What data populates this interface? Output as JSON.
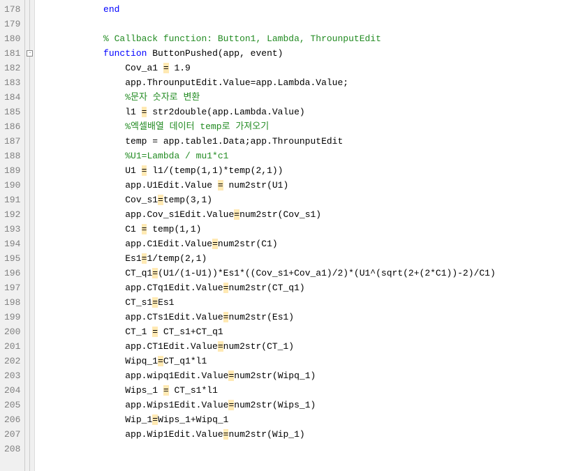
{
  "startLine": 178,
  "endLine": 208,
  "foldLine": 181,
  "lines": [
    {
      "n": 178,
      "tokens": [
        {
          "t": "ind",
          "v": "            "
        },
        {
          "t": "kw",
          "v": "end"
        }
      ]
    },
    {
      "n": 179,
      "tokens": []
    },
    {
      "n": 180,
      "tokens": [
        {
          "t": "ind",
          "v": "            "
        },
        {
          "t": "cm",
          "v": "% Callback function: Button1, Lambda, ThrounputEdit"
        }
      ]
    },
    {
      "n": 181,
      "tokens": [
        {
          "t": "ind",
          "v": "            "
        },
        {
          "t": "kw",
          "v": "function"
        },
        {
          "t": "tx",
          "v": " ButtonPushed(app, event)"
        }
      ]
    },
    {
      "n": 182,
      "tokens": [
        {
          "t": "ind",
          "v": "                "
        },
        {
          "t": "tx",
          "v": "Cov_a1 "
        },
        {
          "t": "op",
          "v": "="
        },
        {
          "t": "tx",
          "v": " 1.9"
        }
      ]
    },
    {
      "n": 183,
      "tokens": [
        {
          "t": "ind",
          "v": "                "
        },
        {
          "t": "tx",
          "v": "app.ThrounputEdit.Value=app.Lambda.Value;"
        }
      ]
    },
    {
      "n": 184,
      "tokens": [
        {
          "t": "ind",
          "v": "                "
        },
        {
          "t": "cm",
          "v": "%문자 숫자로 변환"
        }
      ]
    },
    {
      "n": 185,
      "tokens": [
        {
          "t": "ind",
          "v": "                "
        },
        {
          "t": "tx",
          "v": "l1 "
        },
        {
          "t": "op",
          "v": "="
        },
        {
          "t": "tx",
          "v": " str2double(app.Lambda.Value)"
        }
      ]
    },
    {
      "n": 186,
      "tokens": [
        {
          "t": "ind",
          "v": "                "
        },
        {
          "t": "cm",
          "v": "%엑셀배열 데이터 temp로 가져오기"
        }
      ]
    },
    {
      "n": 187,
      "tokens": [
        {
          "t": "ind",
          "v": "                "
        },
        {
          "t": "tx",
          "v": "temp = app.table1.Data;app.ThrounputEdit"
        }
      ]
    },
    {
      "n": 188,
      "tokens": [
        {
          "t": "ind",
          "v": "                "
        },
        {
          "t": "cm",
          "v": "%U1=Lambda / mu1*c1"
        }
      ]
    },
    {
      "n": 189,
      "tokens": [
        {
          "t": "ind",
          "v": "                "
        },
        {
          "t": "tx",
          "v": "U1 "
        },
        {
          "t": "op",
          "v": "="
        },
        {
          "t": "tx",
          "v": " l1/(temp(1,1)*temp(2,1))"
        }
      ]
    },
    {
      "n": 190,
      "tokens": [
        {
          "t": "ind",
          "v": "                "
        },
        {
          "t": "tx",
          "v": "app.U1Edit.Value "
        },
        {
          "t": "op",
          "v": "="
        },
        {
          "t": "tx",
          "v": " num2str(U1)"
        }
      ]
    },
    {
      "n": 191,
      "tokens": [
        {
          "t": "ind",
          "v": "                "
        },
        {
          "t": "tx",
          "v": "Cov_s1"
        },
        {
          "t": "op",
          "v": "="
        },
        {
          "t": "tx",
          "v": "temp(3,1)"
        }
      ]
    },
    {
      "n": 192,
      "tokens": [
        {
          "t": "ind",
          "v": "                "
        },
        {
          "t": "tx",
          "v": "app.Cov_s1Edit.Value"
        },
        {
          "t": "op",
          "v": "="
        },
        {
          "t": "tx",
          "v": "num2str(Cov_s1)"
        }
      ]
    },
    {
      "n": 193,
      "tokens": [
        {
          "t": "ind",
          "v": "                "
        },
        {
          "t": "tx",
          "v": "C1 "
        },
        {
          "t": "op",
          "v": "="
        },
        {
          "t": "tx",
          "v": " temp(1,1)"
        }
      ]
    },
    {
      "n": 194,
      "tokens": [
        {
          "t": "ind",
          "v": "                "
        },
        {
          "t": "tx",
          "v": "app.C1Edit.Value"
        },
        {
          "t": "op",
          "v": "="
        },
        {
          "t": "tx",
          "v": "num2str(C1)"
        }
      ]
    },
    {
      "n": 195,
      "tokens": [
        {
          "t": "ind",
          "v": "                "
        },
        {
          "t": "tx",
          "v": "Es1"
        },
        {
          "t": "op",
          "v": "="
        },
        {
          "t": "tx",
          "v": "1/temp(2,1)"
        }
      ]
    },
    {
      "n": 196,
      "tokens": [
        {
          "t": "ind",
          "v": "                "
        },
        {
          "t": "tx",
          "v": "CT_q1"
        },
        {
          "t": "op",
          "v": "="
        },
        {
          "t": "tx",
          "v": "(U1/(1-U1))*Es1*((Cov_s1+Cov_a1)/2)*(U1^(sqrt(2+(2*C1))-2)/C1)"
        }
      ]
    },
    {
      "n": 197,
      "tokens": [
        {
          "t": "ind",
          "v": "                "
        },
        {
          "t": "tx",
          "v": "app.CTq1Edit.Value"
        },
        {
          "t": "op",
          "v": "="
        },
        {
          "t": "tx",
          "v": "num2str(CT_q1)"
        }
      ]
    },
    {
      "n": 198,
      "tokens": [
        {
          "t": "ind",
          "v": "                "
        },
        {
          "t": "tx",
          "v": "CT_s1"
        },
        {
          "t": "op",
          "v": "="
        },
        {
          "t": "tx",
          "v": "Es1"
        }
      ]
    },
    {
      "n": 199,
      "tokens": [
        {
          "t": "ind",
          "v": "                "
        },
        {
          "t": "tx",
          "v": "app.CTs1Edit.Value"
        },
        {
          "t": "op",
          "v": "="
        },
        {
          "t": "tx",
          "v": "num2str(Es1)"
        }
      ]
    },
    {
      "n": 200,
      "tokens": [
        {
          "t": "ind",
          "v": "                "
        },
        {
          "t": "tx",
          "v": "CT_1 "
        },
        {
          "t": "op",
          "v": "="
        },
        {
          "t": "tx",
          "v": " CT_s1+CT_q1"
        }
      ]
    },
    {
      "n": 201,
      "tokens": [
        {
          "t": "ind",
          "v": "                "
        },
        {
          "t": "tx",
          "v": "app.CT1Edit.Value"
        },
        {
          "t": "op",
          "v": "="
        },
        {
          "t": "tx",
          "v": "num2str(CT_1)"
        }
      ]
    },
    {
      "n": 202,
      "tokens": [
        {
          "t": "ind",
          "v": "                "
        },
        {
          "t": "tx",
          "v": "Wipq_1"
        },
        {
          "t": "op",
          "v": "="
        },
        {
          "t": "tx",
          "v": "CT_q1*l1"
        }
      ]
    },
    {
      "n": 203,
      "tokens": [
        {
          "t": "ind",
          "v": "                "
        },
        {
          "t": "tx",
          "v": "app.wipq1Edit.Value"
        },
        {
          "t": "op",
          "v": "="
        },
        {
          "t": "tx",
          "v": "num2str(Wipq_1)"
        }
      ]
    },
    {
      "n": 204,
      "tokens": [
        {
          "t": "ind",
          "v": "                "
        },
        {
          "t": "tx",
          "v": "Wips_1 "
        },
        {
          "t": "op",
          "v": "="
        },
        {
          "t": "tx",
          "v": " CT_s1*l1"
        }
      ]
    },
    {
      "n": 205,
      "tokens": [
        {
          "t": "ind",
          "v": "                "
        },
        {
          "t": "tx",
          "v": "app.Wips1Edit.Value"
        },
        {
          "t": "op",
          "v": "="
        },
        {
          "t": "tx",
          "v": "num2str(Wips_1)"
        }
      ]
    },
    {
      "n": 206,
      "tokens": [
        {
          "t": "ind",
          "v": "                "
        },
        {
          "t": "tx",
          "v": "Wip_1"
        },
        {
          "t": "op",
          "v": "="
        },
        {
          "t": "tx",
          "v": "Wips_1+Wipq_1"
        }
      ]
    },
    {
      "n": 207,
      "tokens": [
        {
          "t": "ind",
          "v": "                "
        },
        {
          "t": "tx",
          "v": "app.Wip1Edit.Value"
        },
        {
          "t": "op",
          "v": "="
        },
        {
          "t": "tx",
          "v": "num2str(Wip_1)"
        }
      ]
    },
    {
      "n": 208,
      "tokens": []
    }
  ]
}
